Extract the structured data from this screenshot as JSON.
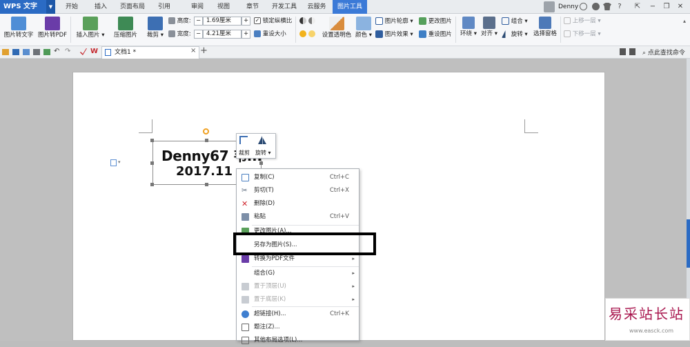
{
  "app": {
    "name": "WPS 文字"
  },
  "tabs": [
    "开始",
    "插入",
    "页面布局",
    "引用",
    "审阅",
    "视图",
    "章节",
    "开发工具",
    "云服务",
    "图片工具"
  ],
  "active_tab": "图片工具",
  "user": {
    "name": "Denny"
  },
  "window_controls": [
    "?"
  ],
  "ribbon": {
    "pic_to_text": "图片转文字",
    "pic_to_pdf": "图片转PDF",
    "insert_pic": "插入图片",
    "compress_pic": "压缩图片",
    "crop": "裁剪",
    "height_label": "高度:",
    "height_value": "1.69厘米",
    "width_label": "宽度:",
    "width_value": "4.21厘米",
    "lock_ratio": "锁定纵横比",
    "reset_size": "重设大小",
    "set_transparent": "设置透明色",
    "color": "颜色",
    "outline": "图片轮廓",
    "effect": "图片效果",
    "change_pic": "更改图片",
    "reset_pic": "重设图片",
    "wrap": "环绕",
    "align": "对齐",
    "rotate": "旋转",
    "group": "组合",
    "rotate2": "旋转",
    "selection_pane": "选择窗格",
    "bring_forward": "上移一层",
    "send_backward": "下移一层",
    "plus": "+",
    "minus": "−"
  },
  "quickbar": {
    "doc_tab": "文档1 *",
    "close": "×",
    "new_tab": "+",
    "search": "点此查找命令"
  },
  "document": {
    "line1": "Denny67 韦...",
    "line2": "2017.11"
  },
  "mini_toolbar": {
    "crop": "裁剪",
    "rotate": "旋转"
  },
  "context_menu": [
    {
      "label": "复制(C)",
      "shortcut": "Ctrl+C",
      "disabled": false
    },
    {
      "label": "剪切(T)",
      "shortcut": "Ctrl+X",
      "disabled": false
    },
    {
      "label": "删除(D)",
      "shortcut": "",
      "disabled": false
    },
    {
      "label": "粘贴",
      "shortcut": "Ctrl+V",
      "disabled": false
    },
    {
      "label": "更改图片(A)...",
      "shortcut": "",
      "disabled": false
    },
    {
      "label": "另存为图片(S)...",
      "shortcut": "",
      "disabled": false
    },
    {
      "label": "转换为PDF文件",
      "shortcut": "",
      "disabled": false
    },
    {
      "label": "组合(G)",
      "shortcut": "",
      "disabled": false
    },
    {
      "label": "置于顶层(U)",
      "shortcut": "",
      "disabled": true
    },
    {
      "label": "置于底层(K)",
      "shortcut": "",
      "disabled": true
    },
    {
      "label": "超链接(H)...",
      "shortcut": "Ctrl+K",
      "disabled": false
    },
    {
      "label": "题注(Z)...",
      "shortcut": "",
      "disabled": false
    },
    {
      "label": "其他布局选项(L)...",
      "shortcut": "",
      "disabled": false
    }
  ],
  "watermark": {
    "text": "易采站长站",
    "url": "www.easck.com"
  },
  "colors": {
    "brand": "#2b6bc4",
    "active_tab": "#3b7ad7",
    "highlight": "#000000",
    "watermark": "#a8154d"
  }
}
